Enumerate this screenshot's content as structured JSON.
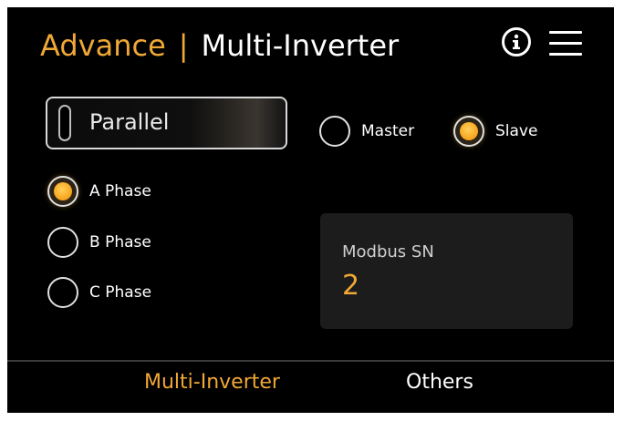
{
  "header": {
    "section": "Advance",
    "separator": "|",
    "page": "Multi-Inverter",
    "info_icon": "info-icon",
    "menu_icon": "hamburger-menu-icon"
  },
  "mode": {
    "value": "Parallel"
  },
  "role": {
    "master_label": "Master",
    "slave_label": "Slave",
    "selected": "Slave"
  },
  "phase": {
    "a_label": "A Phase",
    "b_label": "B Phase",
    "c_label": "C Phase",
    "selected": "A Phase"
  },
  "modbus": {
    "label": "Modbus SN",
    "value": "2"
  },
  "tabs": {
    "multi_inverter": "Multi-Inverter",
    "others": "Others",
    "active": "Multi-Inverter"
  },
  "colors": {
    "accent": "#f0a836",
    "background": "#000000",
    "card": "#1c1c1c"
  }
}
